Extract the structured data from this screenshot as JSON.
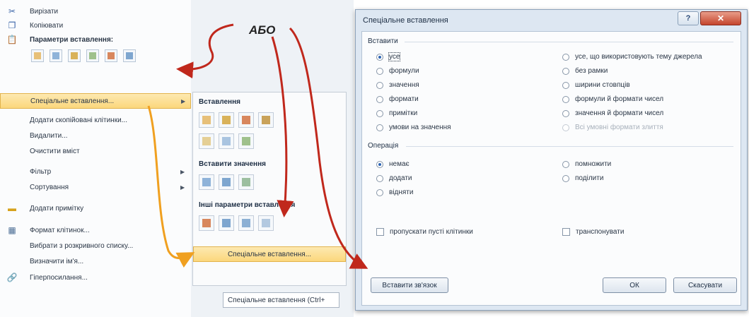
{
  "context_menu": {
    "items": [
      {
        "label": "Вирізати",
        "icon": "cut-icon",
        "bold": false
      },
      {
        "label": "Копіювати",
        "icon": "copy-icon",
        "bold": false
      },
      {
        "label": "Параметри вставлення:",
        "icon": "paste-options-icon",
        "bold": true
      },
      {
        "label": "Спеціальне вставлення...",
        "has_submenu": true,
        "highlighted": true
      },
      {
        "label": "Додати скопійовані клітинки..."
      },
      {
        "label": "Видалити..."
      },
      {
        "label": "Очистити вміст"
      },
      {
        "label": "Фільтр",
        "has_submenu": true
      },
      {
        "label": "Сортування",
        "has_submenu": true
      },
      {
        "label": "Додати примітку",
        "icon": "comment-icon"
      },
      {
        "label": "Формат клітинок...",
        "icon": "format-cells-icon"
      },
      {
        "label": "Вибрати з розкривного списку..."
      },
      {
        "label": "Визначити ім'я..."
      },
      {
        "label": "Гіперпосилання...",
        "icon": "hyperlink-icon"
      }
    ],
    "paste_icons": [
      "paste-icon",
      "paste-values-icon",
      "paste-formulas-icon",
      "paste-transpose-icon",
      "paste-formatting-icon",
      "paste-link-icon"
    ]
  },
  "submenu": {
    "paste_heading": "Вставлення",
    "values_heading": "Вставити значення",
    "other_heading": "Інші параметри вставлення",
    "special_item": "Спеціальне вставлення...",
    "combo_text": "Спеціальне вставлення (Ctrl+"
  },
  "annotation": {
    "label": "АБО"
  },
  "dialog": {
    "title": "Спеціальне вставлення",
    "help_label": "?",
    "close_label": "✕",
    "paste_group": "Вставити",
    "paste_options_left": [
      {
        "label": "усе",
        "checked": true
      },
      {
        "label": "формули",
        "checked": false
      },
      {
        "label": "значення",
        "checked": false
      },
      {
        "label": "формати",
        "checked": false
      },
      {
        "label": "примітки",
        "checked": false
      },
      {
        "label": "умови на значення",
        "checked": false
      }
    ],
    "paste_options_right": [
      {
        "label": "усе, що використовують тему джерела",
        "checked": false,
        "disabled": false
      },
      {
        "label": "без рамки",
        "checked": false,
        "disabled": false
      },
      {
        "label": "ширини стовпців",
        "checked": false,
        "disabled": false
      },
      {
        "label": "формули й формати чисел",
        "checked": false,
        "disabled": false
      },
      {
        "label": "значення й формати чисел",
        "checked": false,
        "disabled": false
      },
      {
        "label": "Всі умовні формати злиття",
        "checked": false,
        "disabled": true
      }
    ],
    "operation_group": "Операція",
    "operation_left": [
      {
        "label": "немає",
        "checked": true
      },
      {
        "label": "додати",
        "checked": false
      },
      {
        "label": "відняти",
        "checked": false
      }
    ],
    "operation_right": [
      {
        "label": "помножити",
        "checked": false
      },
      {
        "label": "поділити",
        "checked": false
      }
    ],
    "skip_blanks": "пропускати пусті клітинки",
    "transpose": "транспонувати",
    "paste_link_button": "Вставити зв'язок",
    "ok_button": "ОК",
    "cancel_button": "Скасувати"
  },
  "colors": {
    "highlight": "#fbd77c",
    "arrow_red": "#c0281c",
    "arrow_orange": "#f0a020"
  }
}
